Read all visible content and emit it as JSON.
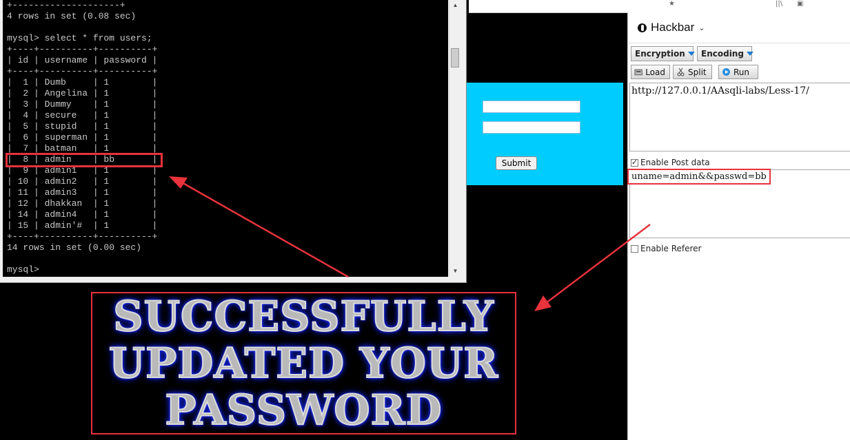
{
  "console": {
    "lines": [
      "+--------------------+",
      "4 rows in set (0.08 sec)",
      "",
      "mysql> select * from users;",
      "+----+----------+----------+",
      "| id | username | password |",
      "+----+----------+----------+",
      "|  1 | Dumb     | 1        |",
      "|  2 | Angelina | 1        |",
      "|  3 | Dummy    | 1        |",
      "|  4 | secure   | 1        |",
      "|  5 | stupid   | 1        |",
      "|  6 | superman | 1        |",
      "|  7 | batman   | 1        |",
      "|  8 | admin    | bb       |",
      "|  9 | admin1   | 1        |",
      "| 10 | admin2   | 1        |",
      "| 11 | admin3   | 1        |",
      "| 12 | dhakkan  | 1        |",
      "| 14 | admin4   | 1        |",
      "| 15 | admin'#  | 1        |",
      "+----+----------+----------+",
      "14 rows in set (0.00 sec)",
      "",
      "mysql>"
    ]
  },
  "form": {
    "submit_label": "Submit"
  },
  "banner": {
    "line1": "SUCCESSFULLY",
    "line2": "UPDATED YOUR",
    "line3": "PASSWORD"
  },
  "hackbar": {
    "title": "Hackbar",
    "encryption_label": "Encryption",
    "encoding_label": "Encoding",
    "load_label": "Load",
    "split_label": "Split",
    "run_label": "Run",
    "url": "http://127.0.0.1/AAsqli-labs/Less-17/",
    "enable_post_label": "Enable Post data",
    "post_data": "uname=admin&&passwd=bb",
    "enable_referer_label": "Enable Referer"
  },
  "colors": {
    "highlight": "#e8323c",
    "page_panel": "#00cdfd",
    "banner_glow": "#1a2cff"
  }
}
